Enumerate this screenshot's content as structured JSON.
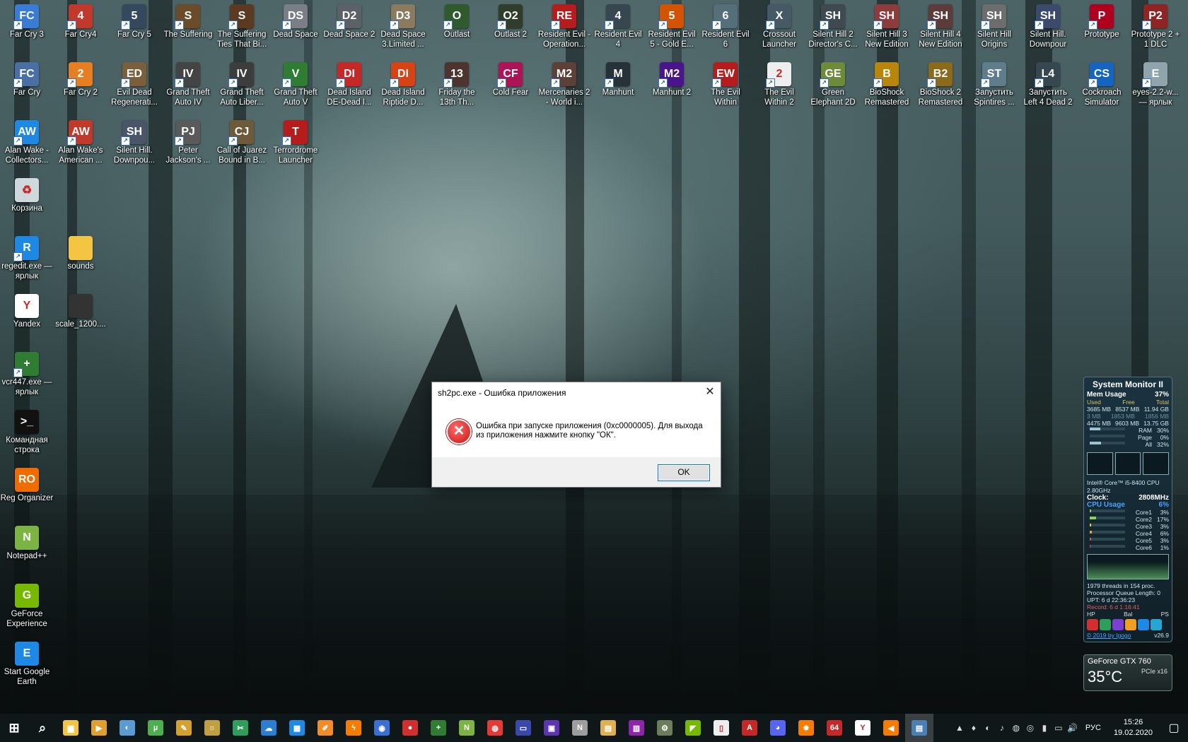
{
  "desktop_icons": [
    {
      "label": "Far Cry 3",
      "color": "#3a7bd5",
      "glyph": "FC"
    },
    {
      "label": "Far Cry4",
      "color": "#c0392b",
      "glyph": "4"
    },
    {
      "label": "Far Cry 5",
      "color": "#34495e",
      "glyph": "5"
    },
    {
      "label": "The Suffering",
      "color": "#6b4c2a",
      "glyph": "S"
    },
    {
      "label": "The Suffering Ties That Bi...",
      "color": "#5a3a20",
      "glyph": "S"
    },
    {
      "label": "Dead Space",
      "color": "#7a7f86",
      "glyph": "DS"
    },
    {
      "label": "Dead Space 2",
      "color": "#5c6168",
      "glyph": "D2"
    },
    {
      "label": "Dead Space 3.Limited ...",
      "color": "#8a7a60",
      "glyph": "D3"
    },
    {
      "label": "Outlast",
      "color": "#2e5a2e",
      "glyph": "O"
    },
    {
      "label": "Outlast 2",
      "color": "#2f3d2a",
      "glyph": "O2"
    },
    {
      "label": "Resident Evil - Operation...",
      "color": "#b71c1c",
      "glyph": "RE"
    },
    {
      "label": "Resident Evil 4",
      "color": "#37474f",
      "glyph": "4"
    },
    {
      "label": "Resident Evil 5 - Gold E...",
      "color": "#d35400",
      "glyph": "5"
    },
    {
      "label": "Resident Evil 6",
      "color": "#546e7a",
      "glyph": "6"
    },
    {
      "label": "Crossout Launcher",
      "color": "#455a64",
      "glyph": "X"
    },
    {
      "label": "Silent Hill 2 Director's C...",
      "color": "#3e4a4f",
      "glyph": "SH"
    },
    {
      "label": "Silent Hill 3 New Edition",
      "color": "#8d3b3b",
      "glyph": "SH"
    },
    {
      "label": "Silent Hill 4 New Edition",
      "color": "#5d3b3b",
      "glyph": "SH"
    },
    {
      "label": "Silent Hill Origins",
      "color": "#6d6d6d",
      "glyph": "SH"
    },
    {
      "label": "Silent Hill. Downpour",
      "color": "#3b4a6d",
      "glyph": "SH"
    },
    {
      "label": "Prototype",
      "color": "#b00020",
      "glyph": "P"
    },
    {
      "label": "Prototype 2 + 1 DLC",
      "color": "#8e2424",
      "glyph": "P2"
    },
    {
      "label": "Far Cry",
      "color": "#4a6fa5",
      "glyph": "FC"
    },
    {
      "label": "Far Cry 2",
      "color": "#e67e22",
      "glyph": "2"
    },
    {
      "label": "Evil Dead Regenerati...",
      "color": "#7b5e3b",
      "glyph": "ED"
    },
    {
      "label": "Grand Theft Auto IV",
      "color": "#444444",
      "glyph": "IV"
    },
    {
      "label": "Grand Theft Auto Liber...",
      "color": "#3d3d3d",
      "glyph": "IV"
    },
    {
      "label": "Grand Theft Auto V",
      "color": "#2e7d32",
      "glyph": "V"
    },
    {
      "label": "Dead Island DE-Dead I...",
      "color": "#c62828",
      "glyph": "DI"
    },
    {
      "label": "Dead Island Riptide D...",
      "color": "#d84315",
      "glyph": "DI"
    },
    {
      "label": "Friday the 13th Th...",
      "color": "#4e342e",
      "glyph": "13"
    },
    {
      "label": "Cold Fear",
      "color": "#ad1457",
      "glyph": "CF"
    },
    {
      "label": "Mercenaries 2 - World i...",
      "color": "#5d4037",
      "glyph": "M2"
    },
    {
      "label": "Manhunt",
      "color": "#263238",
      "glyph": "M"
    },
    {
      "label": "Manhunt 2",
      "color": "#4a148c",
      "glyph": "M2"
    },
    {
      "label": "The Evil Within",
      "color": "#b71c1c",
      "glyph": "EW"
    },
    {
      "label": "The Evil Within 2",
      "color": "#eeeeee",
      "glyph": "2"
    },
    {
      "label": "Green Elephant 2D",
      "color": "#6d8b3a",
      "glyph": "GE"
    },
    {
      "label": "BioShock Remastered",
      "color": "#b8860b",
      "glyph": "B"
    },
    {
      "label": "BioShock 2 Remastered",
      "color": "#8b6b1b",
      "glyph": "B2"
    },
    {
      "label": "Запустить Spintires ...",
      "color": "#607d8b",
      "glyph": "ST"
    },
    {
      "label": "Запустить Left 4 Dead 2",
      "color": "#37474f",
      "glyph": "L4"
    },
    {
      "label": "Cockroach Simulator",
      "color": "#1565c0",
      "glyph": "CS"
    },
    {
      "label": "eyes-2.2-w... — ярлык",
      "color": "#90a4ae",
      "glyph": "E"
    },
    {
      "label": "Alan Wake - Collectors...",
      "color": "#1e88e5",
      "glyph": "AW"
    },
    {
      "label": "Alan Wake's American ...",
      "color": "#c0392b",
      "glyph": "AW"
    },
    {
      "label": "Silent Hill. Downpou...",
      "color": "#4a5568",
      "glyph": "SH"
    },
    {
      "label": "Peter Jackson's ...",
      "color": "#5a5a5a",
      "glyph": "PJ"
    },
    {
      "label": "Call of Juarez Bound in B...",
      "color": "#6d5a3a",
      "glyph": "CJ"
    },
    {
      "label": "Terrordrome Launcher",
      "color": "#b71c1c",
      "glyph": "T"
    },
    {
      "label": "Корзина",
      "color": "#cfd8dc",
      "glyph": "♻"
    },
    {
      "label": "regedit.exe — ярлык",
      "color": "#1e88e5",
      "glyph": "R"
    },
    {
      "label": "sounds",
      "color": "#f4c542",
      "glyph": ""
    },
    {
      "label": "Yandex",
      "color": "#ffffff",
      "glyph": "Y"
    },
    {
      "label": "scale_1200....",
      "color": "#333333",
      "glyph": ""
    },
    {
      "label": "vcr447.exe — ярлык",
      "color": "#2e7d32",
      "glyph": "+"
    },
    {
      "label": "Командная строка",
      "color": "#111111",
      "glyph": ">_"
    },
    {
      "label": "Reg Organizer",
      "color": "#ef6c00",
      "glyph": "RO"
    },
    {
      "label": "Notepad++",
      "color": "#7cb342",
      "glyph": "N"
    },
    {
      "label": "GeForce Experience",
      "color": "#76b900",
      "glyph": "G"
    },
    {
      "label": "Start Google Earth",
      "color": "#1e88e5",
      "glyph": "E"
    }
  ],
  "dialog": {
    "title": "sh2pc.exe - Ошибка приложения",
    "close_glyph": "✕",
    "error_glyph": "✕",
    "message": "Ошибка при запуске приложения (0xc0000005). Для выхода из приложения нажмите кнопку \"ОК\".",
    "ok_label": "OK"
  },
  "system_monitor": {
    "title": "System Monitor II",
    "mem_label": "Mem Usage",
    "mem_pct": "37%",
    "mem_headers": [
      "Used",
      "Free",
      "Total"
    ],
    "mem_rows": [
      [
        "3685 MB",
        "8537 MB",
        "11.94 GB"
      ],
      [
        "3 MB",
        "1853 MB",
        "1856 MB"
      ],
      [
        "4475 MB",
        "9603 MB",
        "13.75 GB"
      ]
    ],
    "bars": [
      {
        "label": "RAM",
        "value": "30%",
        "fill": 30
      },
      {
        "label": "Page",
        "value": "0%",
        "fill": 0
      },
      {
        "label": "All",
        "value": "32%",
        "fill": 32
      }
    ],
    "cpu_name": "Intel® Core™ i5-8400 CPU 2.80GHz",
    "clock_label": "Clock:",
    "clock_value": "2808MHz",
    "cpu_label": "CPU Usage",
    "cpu_pct": "6%",
    "cores": [
      {
        "label": "Core1",
        "value": "3%",
        "fill": 3
      },
      {
        "label": "Core2",
        "value": "17%",
        "fill": 17
      },
      {
        "label": "Core3",
        "value": "3%",
        "fill": 3
      },
      {
        "label": "Core4",
        "value": "6%",
        "fill": 6
      },
      {
        "label": "Core5",
        "value": "3%",
        "fill": 3
      },
      {
        "label": "Core6",
        "value": "1%",
        "fill": 1
      }
    ],
    "threads": "1979 threads in 154 proc.",
    "queue": "Processor Queue Length: 0",
    "uptime": "UPT: 6 d 22:36:23",
    "record": "Record: 6 d 1:16:41",
    "modes": [
      "HP",
      "Bal",
      "PS"
    ],
    "footer": "© 2019 by Igogo",
    "version": "v26.9"
  },
  "gpu": {
    "name": "GeForce GTX 760",
    "temp": "35°C",
    "bus": "PCIe x16"
  },
  "taskbar": {
    "items": [
      {
        "name": "start",
        "glyph": "⊞",
        "color": "transparent"
      },
      {
        "name": "search",
        "glyph": "⌕",
        "color": "transparent"
      },
      {
        "name": "explorer",
        "glyph": "▆",
        "color": "#f4c542"
      },
      {
        "name": "media",
        "glyph": "▶",
        "color": "#e0a030"
      },
      {
        "name": "app-3",
        "glyph": "◐",
        "color": "#5a9bd4"
      },
      {
        "name": "utorrent",
        "glyph": "µ",
        "color": "#4caf50"
      },
      {
        "name": "app-5",
        "glyph": "✎",
        "color": "#d4a030"
      },
      {
        "name": "app-6",
        "glyph": "☼",
        "color": "#c0a040"
      },
      {
        "name": "app-7",
        "glyph": "✂",
        "color": "#2e9e5a"
      },
      {
        "name": "app-8",
        "glyph": "☁",
        "color": "#2a7fd4"
      },
      {
        "name": "app-9",
        "glyph": "▦",
        "color": "#1e88e5"
      },
      {
        "name": "app-10",
        "glyph": "✐",
        "color": "#f28c28"
      },
      {
        "name": "app-11",
        "glyph": "ϟ",
        "color": "#f57c00"
      },
      {
        "name": "app-12",
        "glyph": "◉",
        "color": "#3a6fd4"
      },
      {
        "name": "app-13",
        "glyph": "●",
        "color": "#d32f2f"
      },
      {
        "name": "app-14",
        "glyph": "+",
        "color": "#2e7d32"
      },
      {
        "name": "notepad",
        "glyph": "N",
        "color": "#7cb342"
      },
      {
        "name": "app-16",
        "glyph": "◍",
        "color": "#e53935"
      },
      {
        "name": "app-17",
        "glyph": "▭",
        "color": "#3949ab"
      },
      {
        "name": "app-18",
        "glyph": "▣",
        "color": "#5e35b1"
      },
      {
        "name": "app-19",
        "glyph": "N",
        "color": "#9e9e9e"
      },
      {
        "name": "app-20",
        "glyph": "▤",
        "color": "#e0b050"
      },
      {
        "name": "winrar",
        "glyph": "▥",
        "color": "#8e24aa"
      },
      {
        "name": "app-22",
        "glyph": "⚙",
        "color": "#6d7d5a"
      },
      {
        "name": "nvidia",
        "glyph": "◤",
        "color": "#76b900"
      },
      {
        "name": "document",
        "glyph": "▯",
        "color": "#eeeeee"
      },
      {
        "name": "acrobat",
        "glyph": "A",
        "color": "#c62828"
      },
      {
        "name": "discord",
        "glyph": "◕",
        "color": "#5865f2"
      },
      {
        "name": "app-28",
        "glyph": "✸",
        "color": "#f57c00"
      },
      {
        "name": "aida64",
        "glyph": "64",
        "color": "#c62828"
      },
      {
        "name": "yandex",
        "glyph": "Y",
        "color": "#ffffff"
      },
      {
        "name": "sound-app",
        "glyph": "◀",
        "color": "#f57c00"
      },
      {
        "name": "active-window",
        "glyph": "▤",
        "color": "#4a7fb5"
      }
    ],
    "tray_icons": [
      "▲",
      "♦",
      "◐",
      "♪",
      "◍",
      "◎",
      "▮",
      "▭",
      "🔊"
    ],
    "lang": "РУС",
    "time": "15:26",
    "date": "19.02.2020",
    "notif_glyph": "▢"
  }
}
